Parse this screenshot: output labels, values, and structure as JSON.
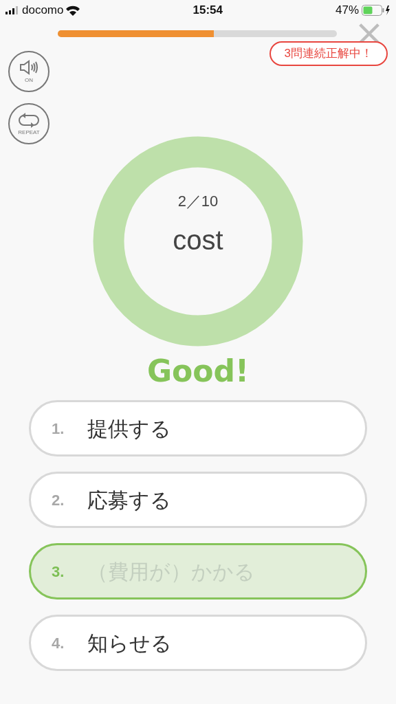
{
  "status_bar": {
    "carrier": "docomo",
    "time": "15:54",
    "battery": "47%"
  },
  "progress": {
    "level": 0.56
  },
  "streak": "3問連続正解中！",
  "sound_button": {
    "label": "ON"
  },
  "repeat_button": {
    "label": "REPEAT"
  },
  "question": {
    "counter": "2／10",
    "word": "cost"
  },
  "feedback": "Good!",
  "options": [
    {
      "number": "1.",
      "text": "提供する",
      "selected": false
    },
    {
      "number": "2.",
      "text": "応募する",
      "selected": false
    },
    {
      "number": "3.",
      "text": "（費用が）かかる",
      "selected": true
    },
    {
      "number": "4.",
      "text": "知らせる",
      "selected": false
    }
  ]
}
